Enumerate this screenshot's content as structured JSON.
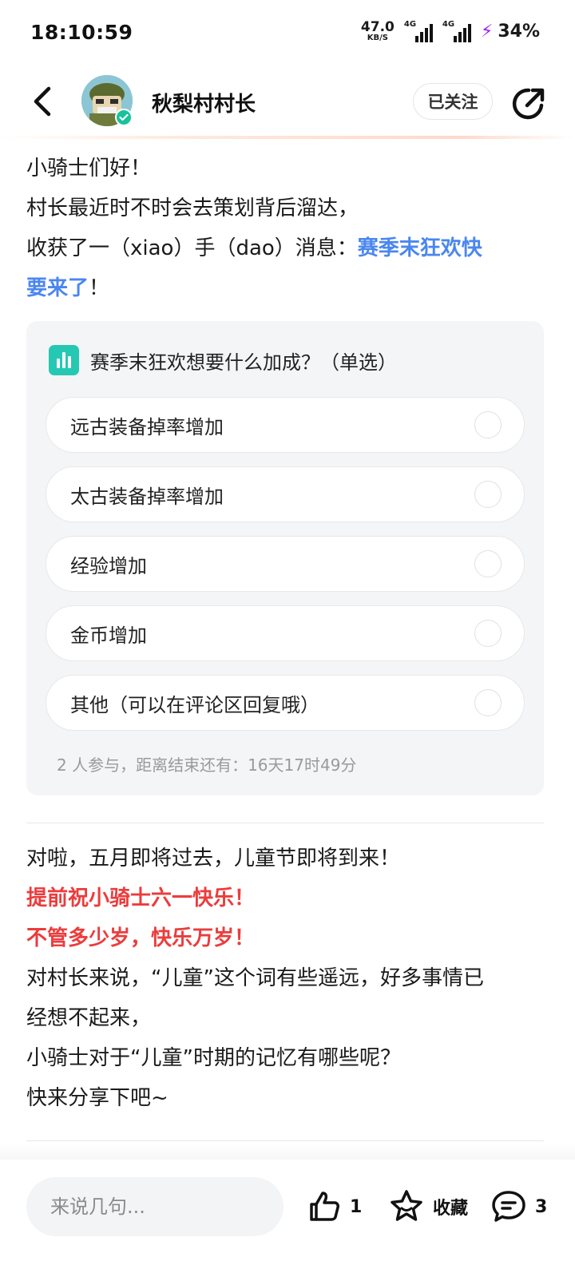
{
  "status_bar": {
    "time": "18:10:59",
    "net_speed_value": "47.0",
    "net_speed_unit": "KB/S",
    "sim1_label": "4G",
    "sim2_label": "4G",
    "battery": "34%"
  },
  "header": {
    "author_name": "秋梨村村长",
    "follow_label": "已关注"
  },
  "post": {
    "intro_line1": "小骑士们好！",
    "intro_line2": "村长最近时不时会去策划背后溜达，",
    "intro_line3_prefix": "收获了一（xiao）手（dao）消息：",
    "intro_line3_highlight": "赛季末狂欢快",
    "intro_line4_highlight": "要来了",
    "intro_line4_suffix": "！",
    "outro_line1": "对啦，五月即将过去，儿童节即将到来！",
    "outro_line2": "提前祝小骑士六一快乐！",
    "outro_line3": "不管多少岁，快乐万岁！",
    "outro_line4": "对村长来说，“儿童”这个词有些遥远，好多事情已",
    "outro_line5": "经想不起来，",
    "outro_line6": "小骑士对于“儿童”时期的记忆有哪些呢？",
    "outro_line7": "快来分享下吧~"
  },
  "poll": {
    "title": "赛季末狂欢想要什么加成？（单选）",
    "options": [
      {
        "label": "远古装备掉率增加"
      },
      {
        "label": "太古装备掉率增加"
      },
      {
        "label": "经验增加"
      },
      {
        "label": "金币增加"
      },
      {
        "label": "其他（可以在评论区回复哦）"
      }
    ],
    "footer": "2 人参与，距离结束还有：16天17时49分"
  },
  "bottom_bar": {
    "comment_placeholder": "来说几句...",
    "like_count": "1",
    "favorite_label": "收藏",
    "comment_count": "3"
  },
  "colors": {
    "highlight_blue": "#4a86f0",
    "highlight_red": "#ec3c3c",
    "poll_icon": "#25c8b2",
    "verified_badge": "#19c29a",
    "charge_bolt": "#a020f0"
  }
}
